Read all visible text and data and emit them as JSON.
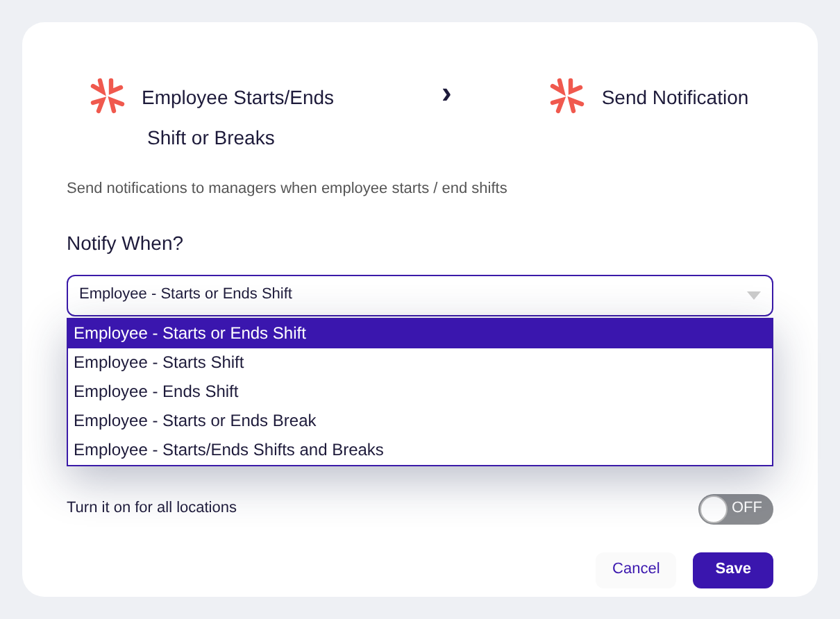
{
  "steps": [
    {
      "label": "Employee Starts/Ends",
      "label_line2": "Shift or Breaks"
    },
    {
      "label": "Send Notification"
    }
  ],
  "separator": "›",
  "description": "Send notifications to managers when employee starts / end shifts",
  "notify": {
    "label": "Notify When?",
    "value": "Employee - Starts or Ends Shift",
    "expanded": true,
    "options": [
      {
        "label": "Employee - Starts or Ends Shift",
        "selected": true
      },
      {
        "label": "Employee - Starts Shift",
        "selected": false
      },
      {
        "label": "Employee - Ends Shift",
        "selected": false
      },
      {
        "label": "Employee - Starts or Ends Break",
        "selected": false
      },
      {
        "label": "Employee - Starts/Ends Shifts and Breaks",
        "selected": false
      }
    ]
  },
  "all_locations": {
    "label": "Turn it on for all locations",
    "on": false,
    "state_text": "OFF"
  },
  "buttons": {
    "cancel": "Cancel",
    "save": "Save"
  }
}
